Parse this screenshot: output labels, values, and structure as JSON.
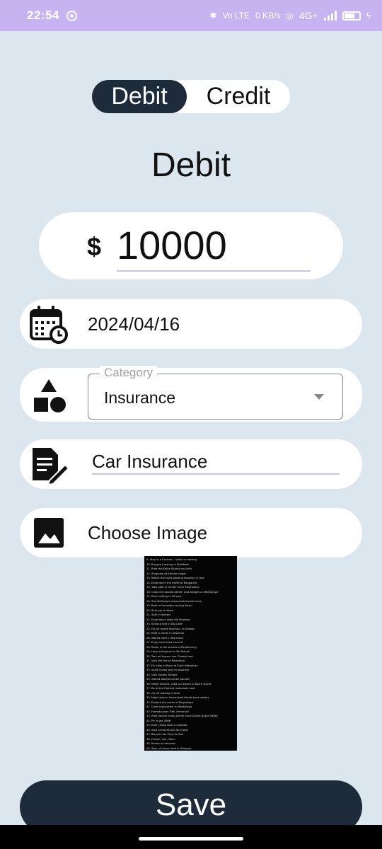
{
  "status_bar": {
    "time": "22:54",
    "network_label": "4G+",
    "data_speed": "0 KB/s",
    "vo_lte": "Vo LTE"
  },
  "toggle": {
    "debit_label": "Debit",
    "credit_label": "Credit",
    "selected": "Debit"
  },
  "page_title": "Debit",
  "amount": {
    "currency": "$",
    "value": "10000"
  },
  "date": {
    "value": "2024/04/16",
    "icon": "calendar-clock-icon"
  },
  "category": {
    "legend": "Category",
    "value": "Insurance",
    "icon": "shapes-icon"
  },
  "description": {
    "value": "Car Insurance",
    "icon": "edit-note-icon"
  },
  "image": {
    "label": "Choose Image",
    "icon": "image-icon"
  },
  "preview_lines": [
    "9. Stay in a Caravan - static or moving",
    "10. Bungee jumping in Rishikesh",
    "11. Ride the Kalka Shimla toy train",
    "12. Shopping at Sarojini nagar",
    "13. Watch the night glowing beaches in Goa",
    "14. Experience the traffic of Bangalore",
    "15. Take bath in Umiam river Meghalaya",
    "16. Cross the double decker root bridges in Meghalaya",
    "17. River rafting in Shivpuri",
    "18. See Rohtang's snow-dusted pine trees",
    "19. Bath in hot water springs Kasol",
    "20. Solo trip to Kasol",
    "21. Spiti in winters",
    "22. Experience night life Mumbai",
    "23. Shikara ride in Dal Lake",
    "24. Go for street food tour in Kolkata",
    "25. Ride a camel in Jaisalmer",
    "26. Attend aarti in Rishikesh",
    "27. Enjoy local tribe concert",
    "28. Roam in the streets of Pondicherry",
    "29. Have a brownie in Old Manali",
    "30. Trek on frozen river Chadar trek",
    "31. Visit the fort of Rajasthan",
    "32. Fly kites in Rann of Kutch Mahotsav",
    "33. Sand Dunes stay in Jaisalmer",
    "34. Visit Golden Temple",
    "35. Attend Wagha border parade",
    "36. White dessert, road to heaven in Kutch Gujrat",
    "37. Be at the Highest motorable road",
    "38. Go off reading in Spiti",
    "39. Night stay in house boat Kerala back waters",
    "40. Explore the caves of Meghalaya",
    "41. Cave exploration in Meghalaya",
    "42. Hampta pass Trek, Himachal",
    "43. Ride double hump camel Sand Dunes Nubra Valley",
    "44. Pit in gol, JBHB",
    "45. Ride yellow taxis in Kolkata",
    "46. Stay at Neemrana fort hotel",
    "47. Bicycle ride Pune to Goa",
    "48. Frozen river, Sissu",
    "49. Kerala in monsoon",
    "50. Stay at house boat in Alleppey"
  ],
  "save_label": "Save",
  "colors": {
    "primary": "#1e2b3a",
    "background": "#dbe6ef",
    "status_bar": "#c5b4f0"
  }
}
